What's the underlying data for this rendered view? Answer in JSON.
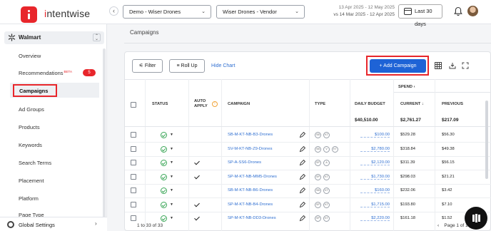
{
  "brand": {
    "name": "intentwise",
    "accent": "#e8262b",
    "link": "#2f6fd1",
    "primary": "#1e63d6"
  },
  "header": {
    "account_dropdown": "Demo - Wiser Drones",
    "profile_dropdown": "Wiser Drones - Vendor",
    "date_range": "13 Apr 2025 - 12 May 2025",
    "compare_range": "vs 14 Mar 2025 - 12 Apr 2025",
    "period_button": "Last 30 days"
  },
  "sidebar": {
    "section": "Walmart",
    "items": [
      {
        "label": "Overview"
      },
      {
        "label": "Recommendations",
        "beta": "BETA",
        "badge": "5"
      },
      {
        "label": "Campaigns",
        "active": true
      },
      {
        "label": "Ad Groups"
      },
      {
        "label": "Products"
      },
      {
        "label": "Keywords"
      },
      {
        "label": "Search Terms"
      },
      {
        "label": "Placement"
      },
      {
        "label": "Platform"
      },
      {
        "label": "Page Type"
      }
    ],
    "footer": "Global Settings"
  },
  "main": {
    "title": "Campaigns",
    "toolbar": {
      "filter": "Filter",
      "rollup": "Roll Up",
      "hide_chart": "Hide Chart",
      "add_campaign": "Add Campaign"
    },
    "table": {
      "group_header": "SPEND",
      "columns": {
        "status": "STATUS",
        "auto_apply": "AUTO APPLY",
        "campaign": "CAMPAIGN",
        "type": "TYPE",
        "daily_budget": "DAILY BUDGET",
        "current": "CURRENT",
        "previous": "PREVIOUS"
      },
      "totals": {
        "daily_budget": "$40,510.00",
        "current": "$2,761.27",
        "previous": "$217.09"
      },
      "rows": [
        {
          "campaign": "SB-M-KT-NB-B3-Drones",
          "types": [
            "SB",
            "KT"
          ],
          "auto": false,
          "budget": "$100.00",
          "current": "$529.28",
          "previous": "$56.30"
        },
        {
          "campaign": "SV-M-KT-NB-Z9-Drones",
          "types": [
            "SB",
            "V",
            "KT"
          ],
          "auto": false,
          "budget": "$2,780.00",
          "current": "$318.84",
          "previous": "$49.38"
        },
        {
          "campaign": "SP-A-SS6-Drones",
          "types": [
            "SP",
            "A"
          ],
          "auto": true,
          "budget": "$2,120.00",
          "current": "$311.39",
          "previous": "$56.15"
        },
        {
          "campaign": "SP-M-KT-NB-MM5-Drones",
          "types": [
            "SP",
            "KT"
          ],
          "auto": true,
          "budget": "$1,730.00",
          "current": "$298.03",
          "previous": "$21.21"
        },
        {
          "campaign": "SB-M-KT-NB-B6-Drones",
          "types": [
            "SB",
            "KT"
          ],
          "auto": false,
          "budget": "$160.00",
          "current": "$232.06",
          "previous": "$3.42"
        },
        {
          "campaign": "SP-M-KT-NB-B4-Drones",
          "types": [
            "SP",
            "KT"
          ],
          "auto": true,
          "budget": "$1,715.00",
          "current": "$193.80",
          "previous": "$7.10"
        },
        {
          "campaign": "SP-M-KT-NB-DD3-Drones",
          "types": [
            "SP",
            "KT"
          ],
          "auto": true,
          "budget": "$2,220.00",
          "current": "$161.18",
          "previous": "$1.52"
        }
      ]
    },
    "footer": {
      "count": "1 to 33 of 33",
      "page": "Page 1 of 1"
    }
  }
}
